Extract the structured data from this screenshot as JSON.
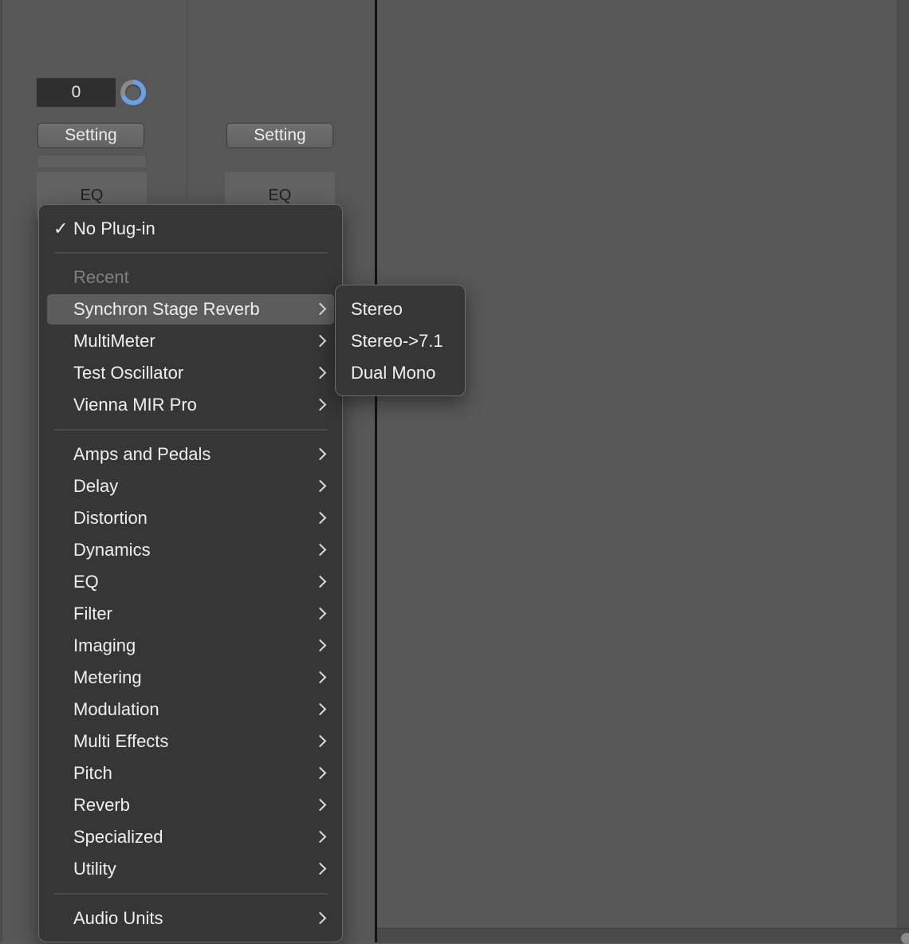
{
  "mixer": {
    "value": "0",
    "setting_label": "Setting",
    "eq_label": "EQ"
  },
  "menu": {
    "selected": "No Plug-in",
    "recent_header": "Recent",
    "recent": [
      {
        "label": "Synchron Stage Reverb"
      },
      {
        "label": "MultiMeter"
      },
      {
        "label": "Test Oscillator"
      },
      {
        "label": "Vienna MIR Pro"
      }
    ],
    "categories": [
      {
        "label": "Amps and Pedals"
      },
      {
        "label": "Delay"
      },
      {
        "label": "Distortion"
      },
      {
        "label": "Dynamics"
      },
      {
        "label": "EQ"
      },
      {
        "label": "Filter"
      },
      {
        "label": "Imaging"
      },
      {
        "label": "Metering"
      },
      {
        "label": "Modulation"
      },
      {
        "label": "Multi Effects"
      },
      {
        "label": "Pitch"
      },
      {
        "label": "Reverb"
      },
      {
        "label": "Specialized"
      },
      {
        "label": "Utility"
      }
    ],
    "audio_units": "Audio Units"
  },
  "submenu": {
    "items": [
      {
        "label": "Stereo"
      },
      {
        "label": "Stereo->7.1"
      },
      {
        "label": "Dual Mono"
      }
    ]
  },
  "colors": {
    "menu_bg": "#363636",
    "highlight": "#5c5c5c",
    "knob_accent": "#6aa0e8"
  }
}
